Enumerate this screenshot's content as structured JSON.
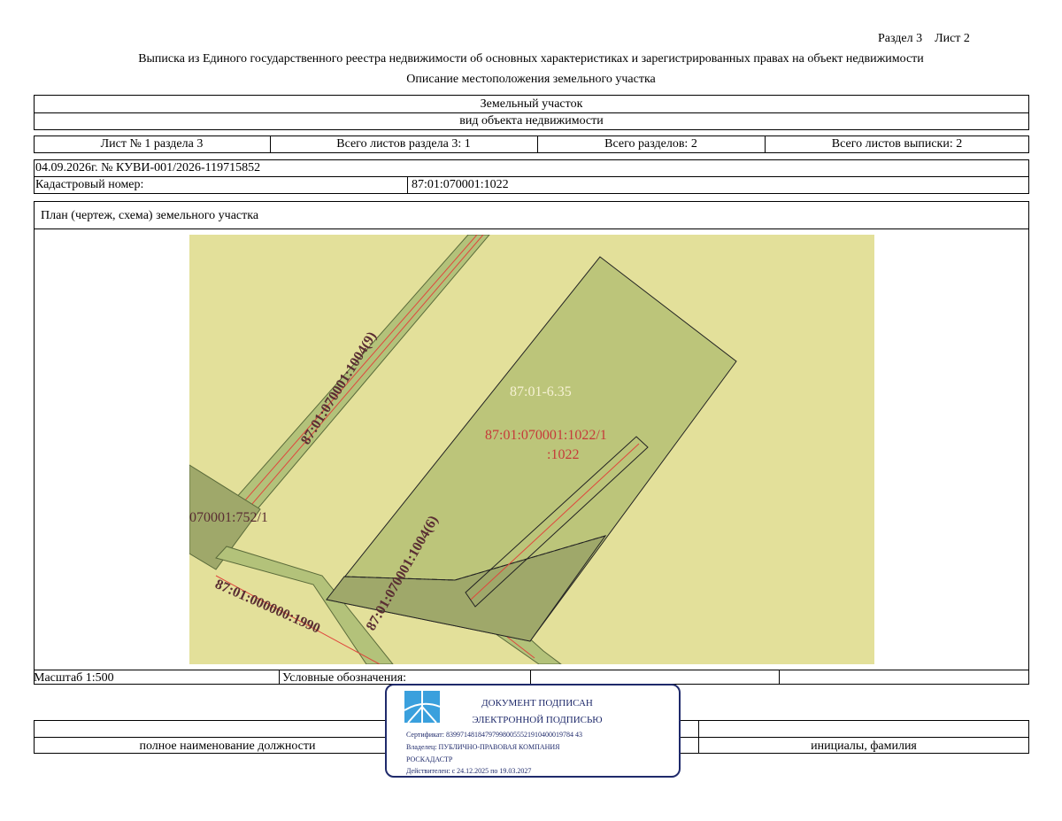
{
  "header": {
    "section_sheet": "Раздел 3    Лист 2",
    "title": "Выписка из Единого государственного реестра недвижимости об основных характеристиках и зарегистрированных правах на объект недвижимости",
    "subtitle": "Описание местоположения земельного участка"
  },
  "object": {
    "name": "Земельный участок",
    "type_caption": "вид объекта недвижимости"
  },
  "sheets": {
    "sheet_of_section": "Лист № 1 раздела 3",
    "total_sheets_section": "Всего листов раздела 3: 1",
    "total_sections": "Всего разделов: 2",
    "total_sheets_extract": "Всего листов выписки: 2"
  },
  "record": {
    "date_number": "04.09.2026г. № КУВИ-001/2026-119715852",
    "cadastral_label": "Кадастровый номер:",
    "cadastral_value": "87:01:070001:1022"
  },
  "plan": {
    "caption": "План (чертеж, схема) земельного участка",
    "labels": {
      "zone": "87:01-6.35",
      "parcel_part": "87:01:070001:1022/1",
      "parcel": ":1022",
      "road_9": "87:01:070001:1004(9)",
      "road_6": "87:01:070001:1004(6)",
      "left_parcel": "070001:752/1",
      "quarter": "87:01:000000:1990"
    },
    "colors": {
      "background": "#e3e09a",
      "parcel_fill": "#bcc57a",
      "dark_fill": "#9fa86a",
      "road_fill": "#b3c27a",
      "red_line": "#e0463c",
      "label_dark": "#5a2e33",
      "label_red": "#c63a3a",
      "label_light": "#f6f1d3"
    }
  },
  "footer": {
    "scale": "Масштаб 1:500",
    "legend": "Условные обозначения:",
    "position_caption": "полное наименование должности",
    "name_caption": "инициалы, фамилия"
  },
  "stamp": {
    "line1": "ДОКУМЕНТ ПОДПИСАН",
    "line2": "ЭЛЕКТРОННОЙ ПОДПИСЬЮ",
    "certificate": "Сертификат: 839971481847979980055521910400019784 43",
    "owner": "Владелец: ПУБЛИЧНО-ПРАВОВАЯ КОМПАНИЯ",
    "owner2": "РОСКАДАСТР",
    "valid": "Действителен: с 24.12.2025 по 19.03.2027",
    "border_color": "#1f2a6b",
    "logo_color": "#3aa0dd"
  }
}
